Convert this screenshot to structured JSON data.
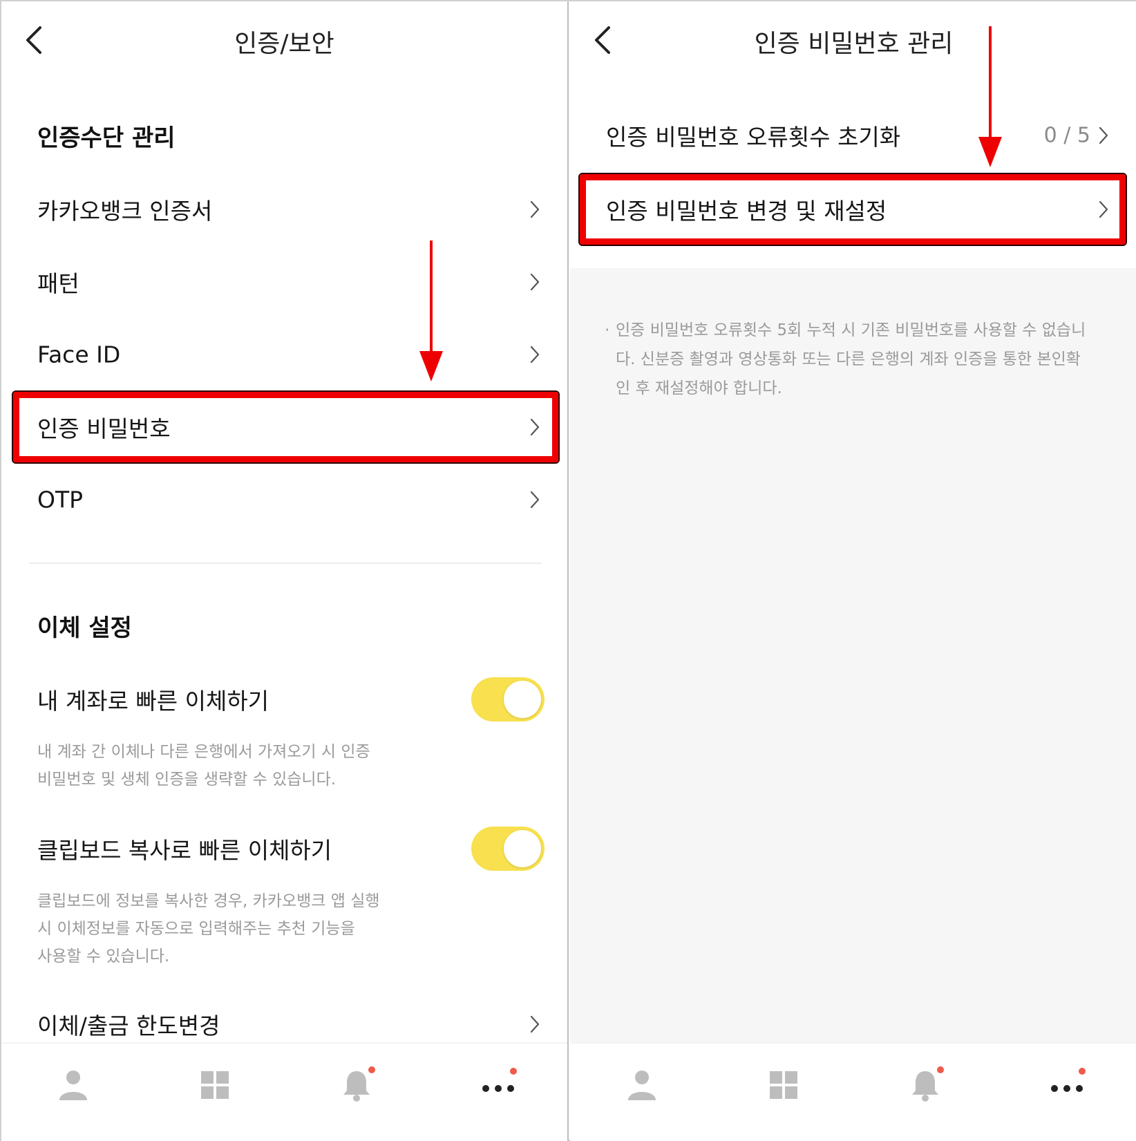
{
  "left": {
    "title": "인증/보안",
    "auth_section": {
      "title": "인증수단 관리",
      "items": [
        {
          "label": "카카오뱅크 인증서"
        },
        {
          "label": "패턴"
        },
        {
          "label": "Face ID"
        },
        {
          "label": "인증 비밀번호"
        },
        {
          "label": "OTP"
        }
      ]
    },
    "transfer_section": {
      "title": "이체 설정",
      "quick_own": {
        "label": "내 계좌로 빠른 이체하기",
        "enabled": true,
        "desc_line1": "내 계좌 간 이체나 다른 은행에서 가져오기 시 인증",
        "desc_line2": "비밀번호 및 생체 인증을 생략할 수 있습니다."
      },
      "quick_clipboard": {
        "label": "클립보드 복사로 빠른 이체하기",
        "enabled": true,
        "desc_line1": "클립보드에 정보를 복사한 경우, 카카오뱅크 앱 실행",
        "desc_line2": "시 이체정보를 자동으로 입력해주는 추천 기능을",
        "desc_line3": "사용할 수 있습니다."
      },
      "limit": {
        "label": "이체/출금 한도변경"
      }
    }
  },
  "right": {
    "title": "인증 비밀번호 관리",
    "items": [
      {
        "label": "인증 비밀번호 오류횟수 초기화",
        "value": "0 / 5"
      },
      {
        "label": "인증 비밀번호 변경 및 재설정"
      }
    ],
    "notice_bullet": "·",
    "notice_line1": "인증 비밀번호 오류횟수 5회 누적 시 기존 비밀번호를 사용할 수 없습니",
    "notice_line2": "다. 신분증 촬영과 영상통화 또는 다른 은행의 계좌 인증을 통한 본인확",
    "notice_line3": "인 후 재설정해야 합니다."
  },
  "tabbar": {
    "icons": [
      "person-icon",
      "grid-icon",
      "bell-icon",
      "more-icon"
    ],
    "badges": {
      "bell": true,
      "more": true
    }
  },
  "colors": {
    "toggle_on": "#f8e04f",
    "highlight": "#ee0000",
    "badge": "#f05a4a",
    "tab_icon": "#bdbdbd",
    "notice_bg": "#f6f6f6"
  }
}
